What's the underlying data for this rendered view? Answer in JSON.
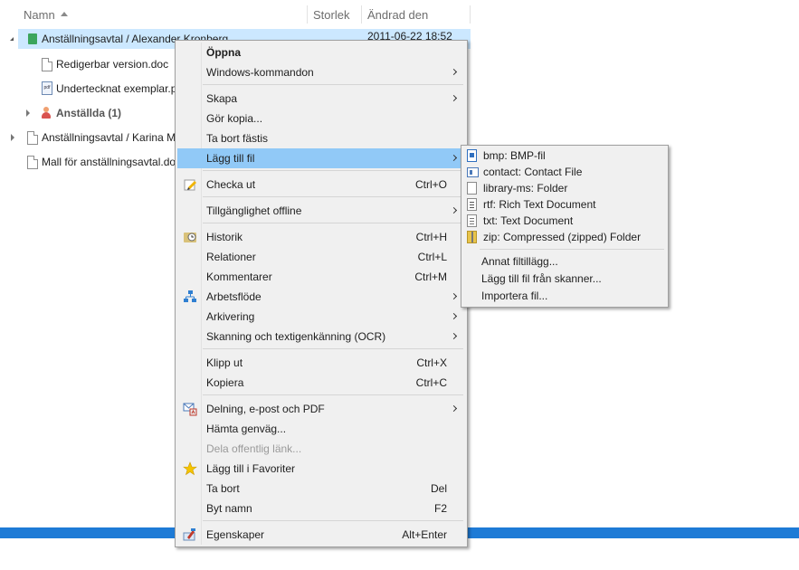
{
  "columns": {
    "name": "Namn",
    "size": "Storlek",
    "modified": "Ändrad den"
  },
  "rows": [
    {
      "name": "Anställningsavtal / Alexander Kronberg",
      "date": "2011-06-22 18:52"
    },
    {
      "name": "Redigerbar version.doc"
    },
    {
      "name": "Undertecknat exemplar.pdf"
    },
    {
      "name": "Anställda (1)"
    },
    {
      "name": "Anställningsavtal / Karina Mattsson"
    },
    {
      "name": "Mall för anställningsavtal.doc"
    }
  ],
  "context_menu": {
    "open": "Öppna",
    "windows_commands": "Windows-kommandon",
    "create": "Skapa",
    "make_copy": "Gör kopia...",
    "remove_pin": "Ta bort fästis",
    "add_file": "Lägg till fil",
    "checkout": "Checka ut",
    "checkout_sc": "Ctrl+O",
    "offline": "Tillgänglighet offline",
    "history": "Historik",
    "history_sc": "Ctrl+H",
    "relations": "Relationer",
    "relations_sc": "Ctrl+L",
    "comments": "Kommentarer",
    "comments_sc": "Ctrl+M",
    "workflow": "Arbetsflöde",
    "archiving": "Arkivering",
    "scan_ocr": "Skanning och textigenkänning (OCR)",
    "cut": "Klipp ut",
    "cut_sc": "Ctrl+X",
    "copy": "Kopiera",
    "copy_sc": "Ctrl+C",
    "share": "Delning, e-post och PDF",
    "get_shortcut": "Hämta genväg...",
    "share_public_link": "Dela offentlig länk...",
    "add_favorites": "Lägg till i Favoriter",
    "delete": "Ta bort",
    "delete_sc": "Del",
    "rename": "Byt namn",
    "rename_sc": "F2",
    "properties": "Egenskaper",
    "properties_sc": "Alt+Enter"
  },
  "submenu": {
    "bmp": "bmp: BMP-fil",
    "contact": "contact: Contact File",
    "library": "library-ms: Folder",
    "rtf": "rtf: Rich Text Document",
    "txt": "txt: Text Document",
    "zip": "zip: Compressed (zipped) Folder",
    "other": "Annat filtillägg...",
    "scanner": "Lägg till fil från skanner...",
    "import": "Importera fil..."
  },
  "colors": {
    "selection": "#cce8ff",
    "menu_highlight": "#91c9f7",
    "accent_bar": "#1e7bd6"
  }
}
